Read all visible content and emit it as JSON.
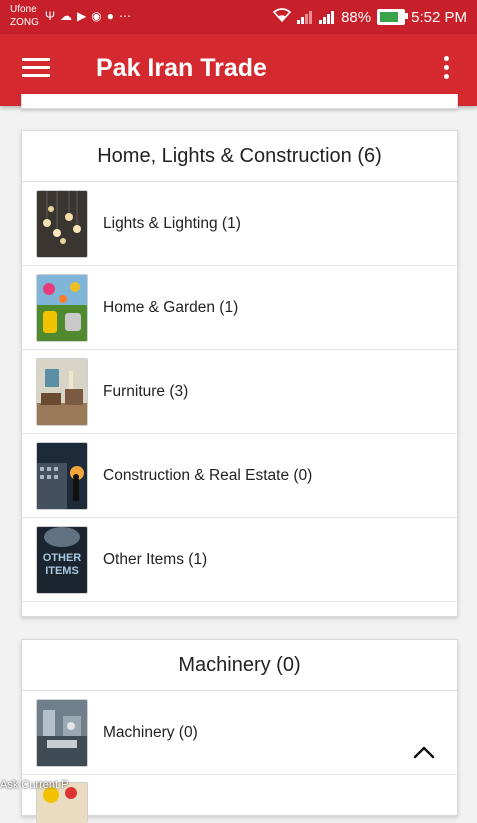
{
  "status_bar": {
    "carrier_1": "Ufone",
    "carrier_2": "ZONG",
    "battery": "88%",
    "time": "5:52 PM",
    "notif_icons": [
      "usb-icon",
      "snapchat-icon",
      "youtube-icon",
      "media-icon",
      "chat-icon",
      "more-dots-icon"
    ]
  },
  "app_bar": {
    "title": "Pak Iran Trade",
    "color": "#d42a2f"
  },
  "categories": [
    {
      "title": "Home, Lights & Construction (6)",
      "items": [
        {
          "label": "Lights & Lighting (1)"
        },
        {
          "label": "Home & Garden (1)"
        },
        {
          "label": "Furniture (3)"
        },
        {
          "label": "Construction & Real Estate (0)"
        },
        {
          "label": "Other Items (1)"
        }
      ]
    },
    {
      "title": "Machinery (0)",
      "items": [
        {
          "label": "Machinery (0)"
        }
      ]
    }
  ],
  "thumb_text": {
    "other_line1": "OTHER",
    "other_line2": "ITEMS"
  },
  "watermark": "Ask Current P"
}
